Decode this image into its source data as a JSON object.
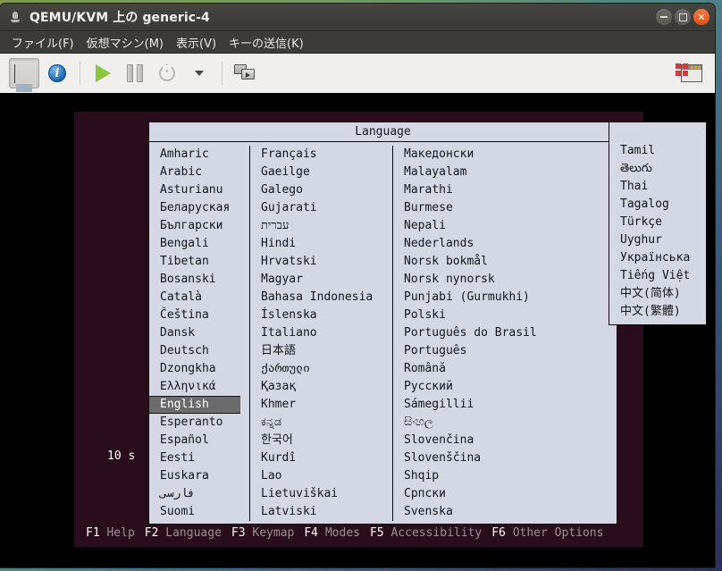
{
  "window": {
    "title": "QEMU/KVM 上の generic-4",
    "title_icon": "computer-icon",
    "buttons": {
      "minimize": "–",
      "maximize": "□",
      "close": "×"
    }
  },
  "menubar": {
    "items": [
      {
        "label": "ファイル(F)",
        "name": "menu-file"
      },
      {
        "label": "仮想マシン(M)",
        "name": "menu-virtual-machine"
      },
      {
        "label": "表示(V)",
        "name": "menu-view"
      },
      {
        "label": "キーの送信(K)",
        "name": "menu-send-key"
      }
    ]
  },
  "toolbar": {
    "items": [
      {
        "name": "show-console-button",
        "icon": "monitor-icon",
        "pressed": true
      },
      {
        "name": "show-details-button",
        "icon": "info-icon",
        "pressed": false
      },
      {
        "name": "run-button",
        "icon": "play-icon",
        "pressed": false
      },
      {
        "name": "pause-button",
        "icon": "pause-icon",
        "pressed": false
      },
      {
        "name": "shutdown-button",
        "icon": "power-icon",
        "pressed": false
      },
      {
        "name": "shutdown-menu-button",
        "icon": "chevron-down-icon",
        "pressed": false
      },
      {
        "name": "snapshots-button",
        "icon": "screens-icon",
        "pressed": false
      },
      {
        "name": "fullscreen-button",
        "icon": "window-icon",
        "pressed": false
      }
    ],
    "info_glyph": "i"
  },
  "installer": {
    "dialog_title": "Language",
    "countdown": "10 s",
    "columns": [
      [
        "Amharic",
        "Arabic",
        "Asturianu",
        "Беларуская",
        "Български",
        "Bengali",
        "Tibetan",
        "Bosanski",
        "Català",
        "Čeština",
        "Dansk",
        "Deutsch",
        "Dzongkha",
        "Ελληνικά",
        "English",
        "Esperanto",
        "Español",
        "Eesti",
        "Euskara",
        "فارسی",
        "Suomi"
      ],
      [
        "Français",
        "Gaeilge",
        "Galego",
        "Gujarati",
        "עברית",
        "Hindi",
        "Hrvatski",
        "Magyar",
        "Bahasa Indonesia",
        "Íslenska",
        "Italiano",
        "日本語",
        "ქართული",
        "Қазақ",
        "Khmer",
        "ಕನ್ನಡ",
        "한국어",
        "Kurdî",
        "Lao",
        "Lietuviškai",
        "Latviski"
      ],
      [
        "Македонски",
        "Malayalam",
        "Marathi",
        "Burmese",
        "Nepali",
        "Nederlands",
        "Norsk bokmål",
        "Norsk nynorsk",
        "Punjabi (Gurmukhi)",
        "Polski",
        "Português do Brasil",
        "Português",
        "Română",
        "Русский",
        "Sámegillii",
        "සිංහල",
        "Slovenčina",
        "Slovenščina",
        "Shqip",
        "Српски",
        "Svenska"
      ],
      [
        "Tamil",
        "తెలుగు",
        "Thai",
        "Tagalog",
        "Türkçe",
        "Uyghur",
        "Українська",
        "Tiếng Việt",
        "中文(简体)",
        "中文(繁體)"
      ]
    ],
    "selected": "English",
    "fkeys": [
      {
        "key": "F1",
        "label": "Help"
      },
      {
        "key": "F2",
        "label": "Language"
      },
      {
        "key": "F3",
        "label": "Keymap"
      },
      {
        "key": "F4",
        "label": "Modes"
      },
      {
        "key": "F5",
        "label": "Accessibility"
      },
      {
        "key": "F6",
        "label": "Other Options"
      }
    ]
  },
  "colors": {
    "installer_bg": "#2a0d1c",
    "dialog_bg": "#d4d8e4",
    "selection_bg": "#6b6b6b",
    "titlebar_bg": "#3c3b37",
    "close_button": "#e24f12"
  }
}
